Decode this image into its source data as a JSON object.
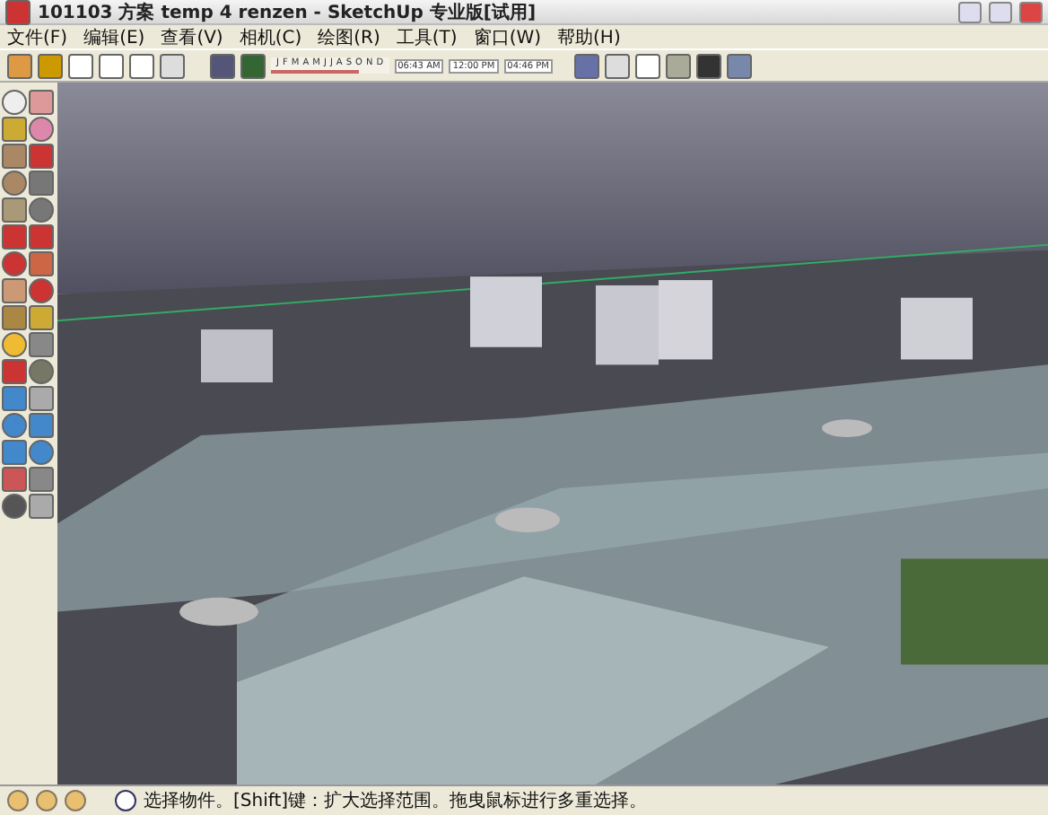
{
  "window": {
    "title": "101103 方案 temp 4 renzen - SketchUp 专业版[试用]"
  },
  "menu": [
    "文件(F)",
    "编辑(E)",
    "查看(V)",
    "相机(C)",
    "绘图(R)",
    "工具(T)",
    "窗口(W)",
    "帮助(H)"
  ],
  "shadow_toolbar": {
    "level": 0.75,
    "months": [
      "J",
      "F",
      "M",
      "A",
      "M",
      "J",
      "J",
      "A",
      "S",
      "O",
      "N",
      "D"
    ],
    "times": [
      "06:43 AM",
      "12:00 PM",
      "04:46 PM"
    ]
  },
  "status_bar": {
    "text": "选择物件。[Shift]键：扩大选择范围。拖曳鼠标进行多重选择。"
  }
}
